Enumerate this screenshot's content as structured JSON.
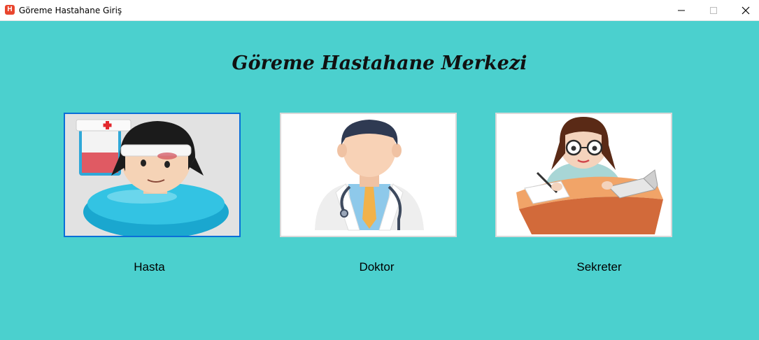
{
  "window": {
    "title": "Göreme Hastahane Giriş",
    "app_icon_letter": "H"
  },
  "main": {
    "heading": "Göreme Hastahane Merkezi",
    "options": [
      {
        "label": "Hasta",
        "icon": "patient-icon"
      },
      {
        "label": "Doktor",
        "icon": "doctor-icon"
      },
      {
        "label": "Sekreter",
        "icon": "secretary-icon"
      }
    ]
  },
  "colors": {
    "background": "#4bd0ce",
    "selected_border": "#0a6fd8"
  }
}
